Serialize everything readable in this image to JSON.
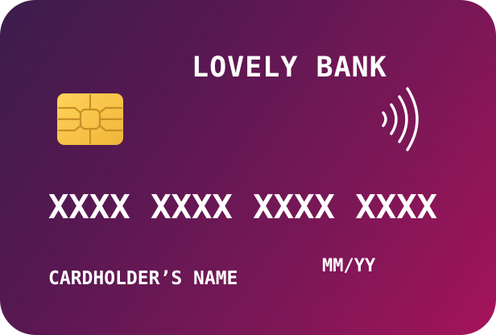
{
  "card": {
    "bank_name": "LOVELY BANK",
    "number": "XXXX XXXX XXXX XXXX",
    "expiry": "MM/YY",
    "holder_name": "CARDHOLDER’S NAME",
    "colors": {
      "gradient_start": "#3b1d4c",
      "gradient_end": "#a5135b",
      "chip_gold": "#f6c54a",
      "text": "#ffffff"
    },
    "icons": [
      "chip-icon",
      "contactless-icon"
    ]
  }
}
